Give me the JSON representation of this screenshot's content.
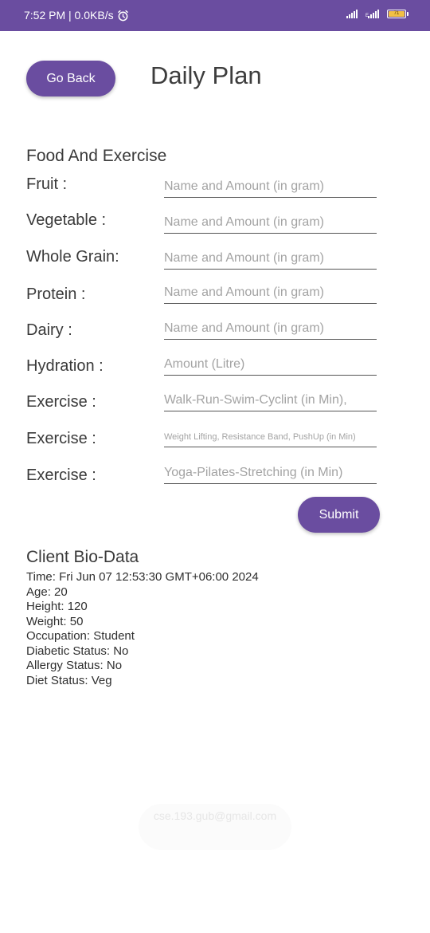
{
  "status_bar": {
    "time_speed": "7:52 PM | 0.0KB/s",
    "battery_level": "71"
  },
  "header": {
    "back_label": "Go Back",
    "title": "Daily Plan"
  },
  "form": {
    "section_title": "Food And Exercise",
    "rows": [
      {
        "label": "Fruit :",
        "placeholder": "Name and Amount (in gram)"
      },
      {
        "label": "Vegetable :",
        "placeholder": "Name and Amount (in gram)"
      },
      {
        "label": "Whole Grain:",
        "placeholder": "Name and Amount (in gram)"
      },
      {
        "label": "Protein :",
        "placeholder": "Name and Amount (in gram)"
      },
      {
        "label": "Dairy :",
        "placeholder": "Name and Amount (in gram)"
      },
      {
        "label": "Hydration :",
        "placeholder": "Amount (Litre)"
      },
      {
        "label": "Exercise :",
        "placeholder": "Walk-Run-Swim-Cyclint (in Min),"
      },
      {
        "label": "Exercise :",
        "placeholder": "Weight Lifting, Resistance Band, PushUp (in Min)"
      },
      {
        "label": "Exercise :",
        "placeholder": "Yoga-Pilates-Stretching (in Min)"
      }
    ],
    "submit_label": "Submit"
  },
  "bio": {
    "title": "Client Bio-Data",
    "lines": [
      "Time: Fri Jun 07 12:53:30 GMT+06:00 2024",
      "Age: 20",
      "Height: 120",
      "Weight: 50",
      "Occupation: Student",
      "Diabetic Status: No",
      "Allergy Status: No",
      "Diet Status: Veg"
    ]
  },
  "footer": {
    "email": "cse.193.gub@gmail.com"
  },
  "colors": {
    "accent": "#6a4da0",
    "battery": "#f2c044"
  }
}
